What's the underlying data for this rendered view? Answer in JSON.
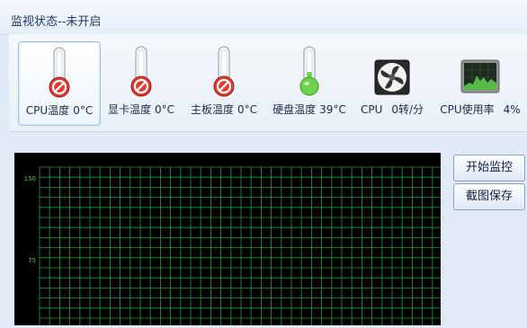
{
  "window": {
    "title": "监视状态--未开启"
  },
  "sensors": [
    {
      "name": "CPU温度",
      "value": "0°C",
      "icon": "thermometer-disabled-icon",
      "selected": true
    },
    {
      "name": "显卡温度",
      "value": "0°C",
      "icon": "thermometer-disabled-icon",
      "selected": false
    },
    {
      "name": "主板温度",
      "value": "0°C",
      "icon": "thermometer-disabled-icon",
      "selected": false
    },
    {
      "name": "硬盘温度",
      "value": "39°C",
      "icon": "thermometer-green-icon",
      "selected": false
    },
    {
      "name": "CPU",
      "value": "0转/分",
      "icon": "fan-icon",
      "selected": false
    },
    {
      "name": "CPU使用率",
      "value": "4%",
      "icon": "cpu-usage-monitor-icon",
      "selected": false
    }
  ],
  "buttons": {
    "start_monitor": "开始监控",
    "screenshot_save": "截图保存"
  },
  "chart_data": {
    "type": "line",
    "y_ticks": [
      "150",
      "75"
    ],
    "grid": true,
    "series": [],
    "colors": {
      "background": "#000000",
      "grid": "#1f9a3a",
      "tick_text": "#2fd04d"
    }
  }
}
